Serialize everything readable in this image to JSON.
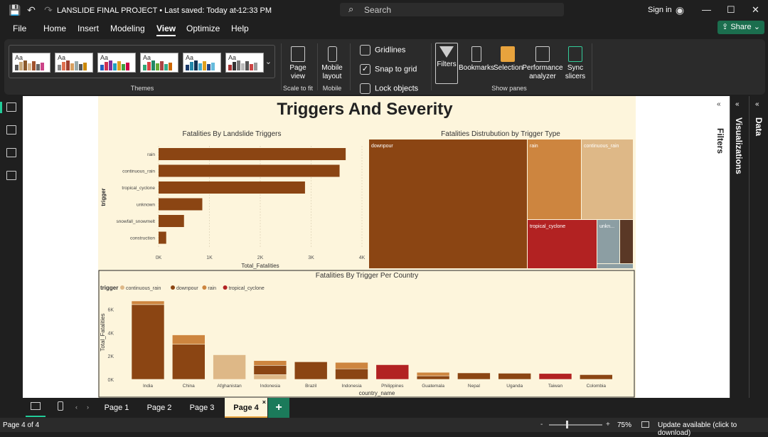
{
  "titlebar": {
    "title": "LANSLIDE FINAL PROJECT • Last saved: Today at 12:33 PM",
    "search_placeholder": "Search",
    "sign_in": "Sign in"
  },
  "menu": [
    "File",
    "Home",
    "Insert",
    "Modeling",
    "View",
    "Optimize",
    "Help"
  ],
  "menu_active": "View",
  "share_label": "Share",
  "ribbon": {
    "themes_label": "Themes",
    "page_view": "Page view",
    "scale_to_fit": "Scale to fit",
    "mobile_layout": "Mobile layout",
    "mobile": "Mobile",
    "gridlines": "Gridlines",
    "snap_to_grid": "Snap to grid",
    "lock_objects": "Lock objects",
    "filters": "Filters",
    "bookmarks": "Bookmarks",
    "selection": "Selection",
    "performance_analyzer": "Performance analyzer",
    "sync_slicers": "Sync slicers",
    "show_panes": "Show panes"
  },
  "panes": {
    "filters": "Filters",
    "visualizations": "Visualizations",
    "data": "Data"
  },
  "report": {
    "title": "Triggers And Severity"
  },
  "chart_data": [
    {
      "type": "bar",
      "orientation": "horizontal",
      "title": "Fatalities By Landslide Triggers",
      "xlabel": "Total_Fatalities",
      "ylabel": "trigger",
      "categories": [
        "rain",
        "continuous_rain",
        "tropical_cyclone",
        "unknown",
        "snowfall_snowmelt",
        "construction"
      ],
      "values": [
        3680,
        3560,
        2880,
        860,
        500,
        150
      ],
      "xlim": [
        0,
        4000
      ],
      "xticks": [
        "0K",
        "1K",
        "2K",
        "3K",
        "4K"
      ],
      "color": "#8b4513"
    },
    {
      "type": "treemap",
      "title": "Fatalities Distrubution by Trigger Type",
      "labels": [
        "downpour",
        "rain",
        "continuous_rain",
        "tropical_cyclone",
        "unkn..."
      ],
      "colors": {
        "downpour": "#8b4513",
        "rain": "#cd853f",
        "continuous_rain": "#deb887",
        "tropical_cyclone": "#b22222",
        "unknown": "#8c9ea3",
        "other": "#5a3826"
      }
    },
    {
      "type": "bar",
      "stacked": true,
      "title": "Fatalities By Trigger Per Country",
      "xlabel": "country_name",
      "ylabel": "Total_Fatalities",
      "legend_title": "trigger",
      "legend_position": "top-left",
      "series": [
        {
          "name": "continuous_rain",
          "color": "#deb887"
        },
        {
          "name": "downpour",
          "color": "#8b4513"
        },
        {
          "name": "rain",
          "color": "#cd853f"
        },
        {
          "name": "tropical_cyclone",
          "color": "#b22222"
        }
      ],
      "categories": [
        "India",
        "China",
        "Afghanistan",
        "Indonesia",
        "Brazil",
        "Indonesia",
        "Philippines",
        "Guatemala",
        "Nepal",
        "Uganda",
        "Taiwan",
        "Colombia"
      ],
      "ylim": [
        0,
        7000
      ],
      "yticks": [
        "0K",
        "2K",
        "4K",
        "6K"
      ],
      "stacks": [
        [
          [
            "downpour",
            6400
          ],
          [
            "rain",
            300
          ]
        ],
        [
          [
            "downpour",
            3000
          ],
          [
            "rain",
            800
          ]
        ],
        [
          [
            "continuous_rain",
            2100
          ]
        ],
        [
          [
            "continuous_rain",
            400
          ],
          [
            "downpour",
            800
          ],
          [
            "rain",
            400
          ]
        ],
        [
          [
            "downpour",
            1500
          ]
        ],
        [
          [
            "downpour",
            900
          ],
          [
            "rain",
            550
          ]
        ],
        [
          [
            "tropical_cyclone",
            1250
          ]
        ],
        [
          [
            "downpour",
            300
          ],
          [
            "rain",
            300
          ]
        ],
        [
          [
            "downpour",
            550
          ]
        ],
        [
          [
            "downpour",
            520
          ]
        ],
        [
          [
            "tropical_cyclone",
            500
          ]
        ],
        [
          [
            "downpour",
            400
          ]
        ]
      ]
    }
  ],
  "tabs": [
    "Page 1",
    "Page 2",
    "Page 3",
    "Page 4"
  ],
  "active_tab": "Page 4",
  "status": {
    "page": "Page 4 of 4",
    "zoom": "75%",
    "update": "Update available (click to download)"
  }
}
